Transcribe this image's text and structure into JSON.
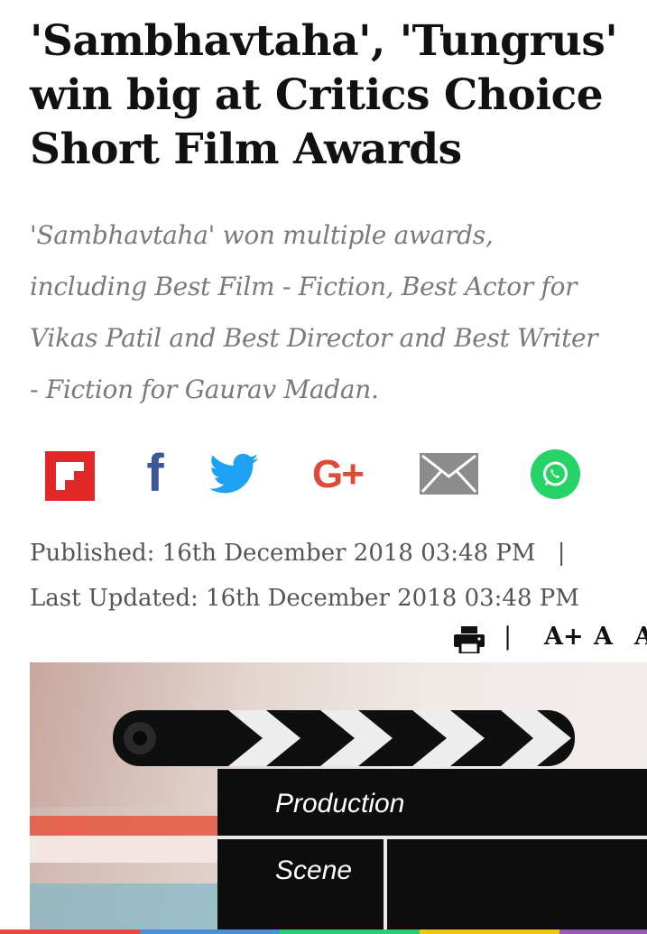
{
  "article": {
    "headline_lines": [
      "'Sambhavtaha', 'Tungrus'",
      "win big at Critics Choice",
      "Short Film Awards"
    ],
    "summary_lines": [
      "'Sambhavtaha' won multiple awards,",
      "including Best Film - Fiction, Best Actor for",
      "Vikas Patil and Best Director and Best Writer",
      "- Fiction for Gaurav Madan."
    ],
    "published_label": "Published:",
    "published_value": "16th December 2018 03:48 PM",
    "separator": "|",
    "updated_label": "Last Updated:",
    "updated_value": "16th December 2018 03:48 PM"
  },
  "share": {
    "icons": [
      "flipboard-icon",
      "facebook-icon",
      "twitter-icon",
      "google-plus-icon",
      "email-icon",
      "whatsapp-icon"
    ],
    "facebook_glyph": "f",
    "google_plus_glyph": "G+",
    "colors": {
      "flipboard": "#e12828",
      "facebook": "#3b5998",
      "twitter": "#1da1f2",
      "google_plus": "#dd4b39",
      "email": "#8c8c8c",
      "whatsapp": "#25d366"
    }
  },
  "tools": {
    "print_icon": "print-icon",
    "divider": "|",
    "font_increase": "A+",
    "font_normal": "A",
    "font_decrease": "A"
  },
  "image": {
    "clapper_top_text": "Production",
    "clapper_bottom_text": "Scene"
  }
}
